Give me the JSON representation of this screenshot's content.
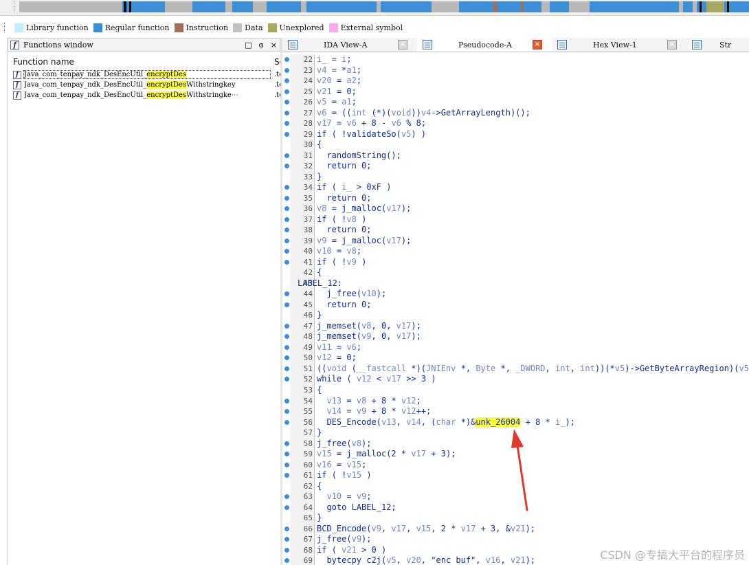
{
  "legend": [
    {
      "label": "Library function",
      "color": "#bff0ff"
    },
    {
      "label": "Regular function",
      "color": "#3c8fd6"
    },
    {
      "label": "Instruction",
      "color": "#a0705a"
    },
    {
      "label": "Data",
      "color": "#c2c2c2"
    },
    {
      "label": "Unexplored",
      "color": "#a8a860"
    },
    {
      "label": "External symbol",
      "color": "#ffa8f0"
    }
  ],
  "functions_window": {
    "title": "Functions window",
    "controls": [
      "□",
      "ɞ",
      "×"
    ],
    "column_name": "Function name",
    "column_segment": "Segment",
    "rows": [
      {
        "prefix": "Java_com_tenpay_ndk_DesEncUtil_",
        "match": "encryptDes",
        "suffix": "",
        "segment": ".text"
      },
      {
        "prefix": "Java_com_tenpay_ndk_DesEncUtil_",
        "match": "encryptDes",
        "suffix": "Withstringkey",
        "segment": ".text"
      },
      {
        "prefix": "Java_com_tenpay_ndk_DesEncUtil_",
        "match": "encryptDes",
        "suffix": "Withstringke⋯",
        "segment": ".text"
      }
    ]
  },
  "tabs": [
    {
      "label": "IDA View-A",
      "active": false
    },
    {
      "label": "Pseudocode-A",
      "active": true
    },
    {
      "label": "Hex View-1",
      "active": false
    },
    {
      "label": "Str",
      "active": false
    }
  ],
  "code": [
    {
      "n": "22",
      "dot": true,
      "src": "i_ = i;"
    },
    {
      "n": "23",
      "dot": true,
      "src": "v4 = *a1;"
    },
    {
      "n": "24",
      "dot": true,
      "src": "v20 = a2;"
    },
    {
      "n": "25",
      "dot": true,
      "src": "v21 = 0;"
    },
    {
      "n": "26",
      "dot": true,
      "src": "v5 = a1;"
    },
    {
      "n": "27",
      "dot": true,
      "src": "v6 = ((int (*)(void))v4->GetArrayLength)();"
    },
    {
      "n": "28",
      "dot": true,
      "src": "v17 = v6 + 8 - v6 % 8;"
    },
    {
      "n": "29",
      "dot": true,
      "src": "if ( !validateSo(v5) )"
    },
    {
      "n": "30",
      "dot": false,
      "src": "{"
    },
    {
      "n": "31",
      "dot": true,
      "src": "  randomString();"
    },
    {
      "n": "32",
      "dot": true,
      "src": "  return 0;"
    },
    {
      "n": "33",
      "dot": false,
      "src": "}"
    },
    {
      "n": "34",
      "dot": true,
      "src": "if ( i_ > 0xF )"
    },
    {
      "n": "35",
      "dot": true,
      "src": "  return 0;"
    },
    {
      "n": "36",
      "dot": true,
      "src": "v8 = j_malloc(v17);"
    },
    {
      "n": "37",
      "dot": true,
      "src": "if ( !v8 )"
    },
    {
      "n": "38",
      "dot": true,
      "src": "  return 0;"
    },
    {
      "n": "39",
      "dot": true,
      "src": "v9 = j_malloc(v17);"
    },
    {
      "n": "40",
      "dot": true,
      "src": "v10 = v8;"
    },
    {
      "n": "41",
      "dot": true,
      "src": "if ( !v9 )"
    },
    {
      "n": "42",
      "dot": false,
      "src": "{"
    },
    {
      "n": "43",
      "dot": false,
      "src": "LABEL_12:",
      "label": true
    },
    {
      "n": "44",
      "dot": true,
      "src": "  j_free(v10);"
    },
    {
      "n": "45",
      "dot": true,
      "src": "  return 0;"
    },
    {
      "n": "46",
      "dot": false,
      "src": "}"
    },
    {
      "n": "47",
      "dot": true,
      "src": "j_memset(v8, 0, v17);"
    },
    {
      "n": "48",
      "dot": true,
      "src": "j_memset(v9, 0, v17);"
    },
    {
      "n": "49",
      "dot": true,
      "src": "v11 = v6;"
    },
    {
      "n": "50",
      "dot": true,
      "src": "v12 = 0;"
    },
    {
      "n": "51",
      "dot": true,
      "src": "((void (__fastcall *)(JNIEnv *, Byte *, _DWORD, int, int))(*v5)->GetByteArrayRegion)(v5"
    },
    {
      "n": "52",
      "dot": true,
      "src": "while ( v12 < v17 >> 3 )"
    },
    {
      "n": "53",
      "dot": false,
      "src": "{"
    },
    {
      "n": "54",
      "dot": true,
      "src": "  v13 = v8 + 8 * v12;"
    },
    {
      "n": "55",
      "dot": true,
      "src": "  v14 = v9 + 8 * v12++;"
    },
    {
      "n": "56",
      "dot": true,
      "src": "  DES_Encode(v13, v14, (char *)&unk_26004 + 8 * i_);"
    },
    {
      "n": "57",
      "dot": false,
      "src": "}"
    },
    {
      "n": "58",
      "dot": true,
      "src": "j_free(v8);"
    },
    {
      "n": "59",
      "dot": true,
      "src": "v15 = j_malloc(2 * v17 + 3);"
    },
    {
      "n": "60",
      "dot": true,
      "src": "v16 = v15;"
    },
    {
      "n": "61",
      "dot": true,
      "src": "if ( !v15 )"
    },
    {
      "n": "62",
      "dot": false,
      "src": "{"
    },
    {
      "n": "63",
      "dot": true,
      "src": "  v10 = v9;"
    },
    {
      "n": "64",
      "dot": true,
      "src": "  goto LABEL_12;"
    },
    {
      "n": "65",
      "dot": false,
      "src": "}"
    },
    {
      "n": "66",
      "dot": true,
      "src": "BCD_Encode(v9, v17, v15, 2 * v17 + 3, &v21);"
    },
    {
      "n": "67",
      "dot": true,
      "src": "j_free(v9);"
    },
    {
      "n": "68",
      "dot": true,
      "src": "if ( v21 > 0 )"
    },
    {
      "n": "69",
      "dot": true,
      "src": "  bytecpy c2j(v5, v20, \"enc buf\", v16, v21);"
    }
  ],
  "highlight_token": "unk_26004",
  "watermark": "CSDN @专搞大平台的程序员"
}
